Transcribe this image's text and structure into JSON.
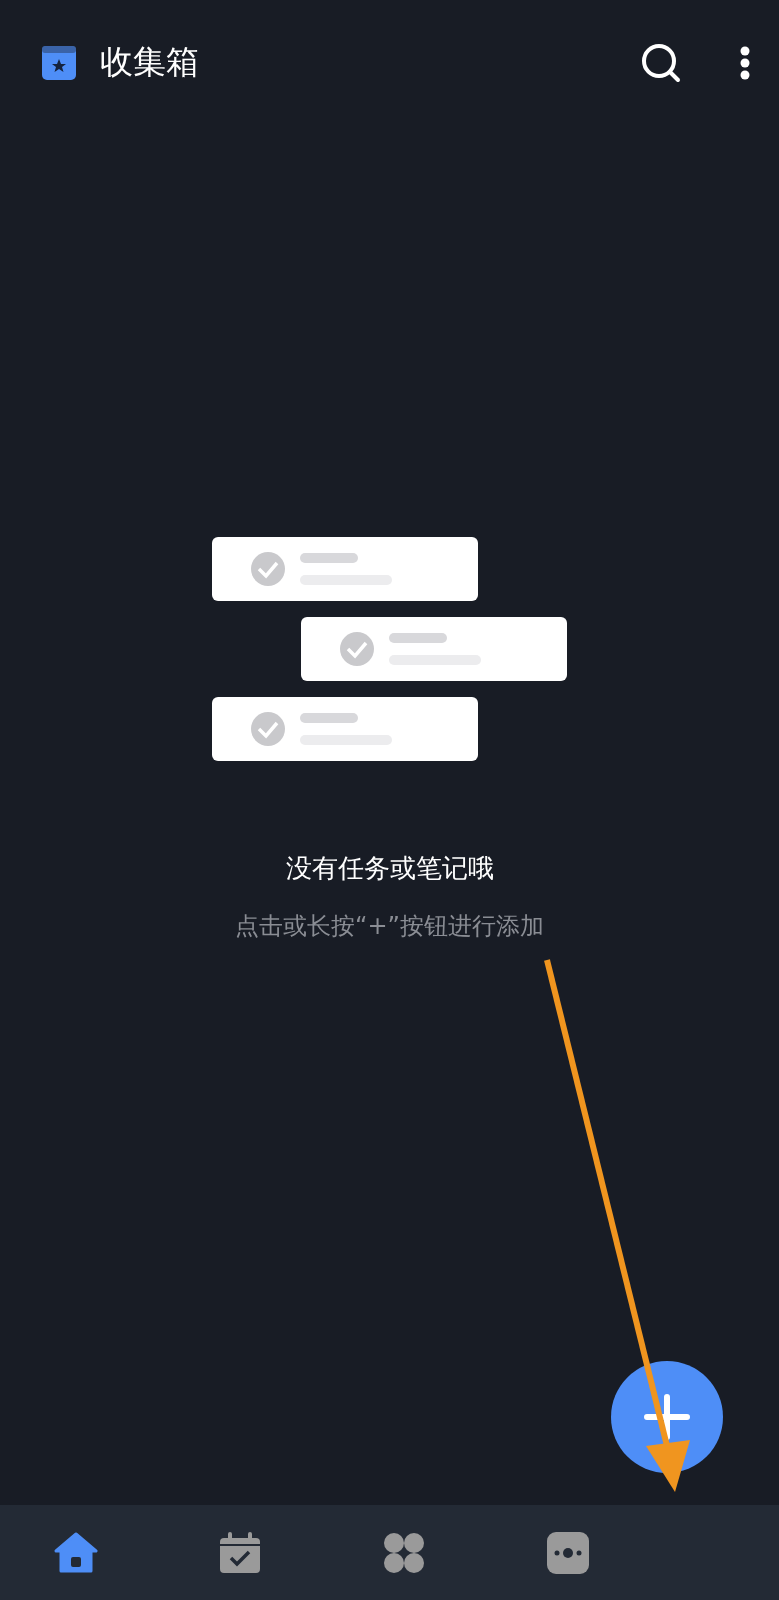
{
  "header": {
    "title": "收集箱"
  },
  "empty_state": {
    "title": "没有任务或笔记哦",
    "hint": "点击或长按“+”按钮进行添加"
  },
  "bottom_nav": [
    {
      "kind": "home",
      "selected": true
    },
    {
      "kind": "calendar",
      "selected": false
    },
    {
      "kind": "grid",
      "selected": false
    },
    {
      "kind": "more",
      "selected": false
    }
  ]
}
